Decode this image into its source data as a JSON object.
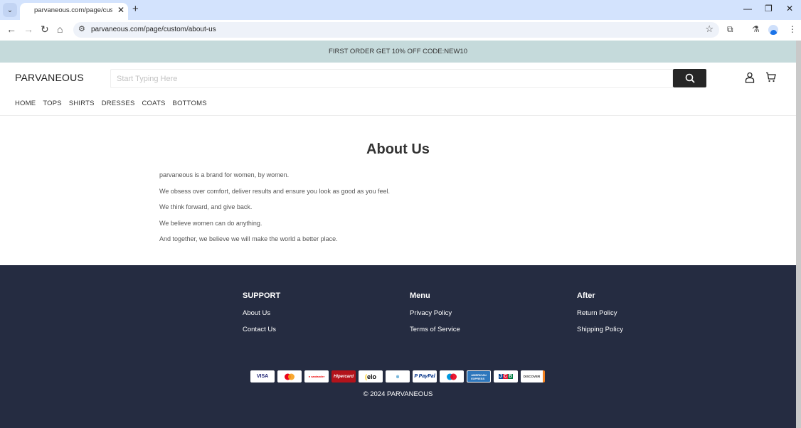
{
  "browser": {
    "tab_title": "parvaneous.com/page/custom/about-us",
    "url": "parvaneous.com/page/custom/about-us"
  },
  "promo": {
    "text": "FIRST ORDER GET 10% OFF CODE:NEW10"
  },
  "header": {
    "logo": "PARVANEOUS",
    "search_placeholder": "Start Typing Here",
    "search_value": "",
    "nav": [
      "HOME",
      "TOPS",
      "SHIRTS",
      "DRESSES",
      "COATS",
      "BOTTOMS"
    ]
  },
  "about": {
    "title": "About Us",
    "paragraphs": [
      "parvaneous is a brand for women, by women.",
      "We obsess over comfort, deliver results and ensure you look as good as you feel.",
      "We think forward, and give back.",
      "We believe women can do anything.",
      "And together, we believe we will make the world a better place."
    ]
  },
  "footer": {
    "columns": [
      {
        "heading": "SUPPORT",
        "links": [
          "About Us",
          "Contact Us"
        ]
      },
      {
        "heading": "Menu",
        "links": [
          "Privacy Policy",
          "Terms of Service"
        ]
      },
      {
        "heading": "After",
        "links": [
          "Return Policy",
          "Shipping Policy"
        ]
      }
    ],
    "payment_methods": [
      "VISA",
      "Mastercard",
      "Santander",
      "Hipercard",
      "elo",
      "Diners Club",
      "PayPal",
      "Maestro",
      "American Express",
      "JCB",
      "Discover"
    ],
    "copyright": "© 2024 PARVANEOUS"
  },
  "colors": {
    "promo_bg": "#c5dadb",
    "footer_bg": "#252c41",
    "search_button": "#262626"
  }
}
